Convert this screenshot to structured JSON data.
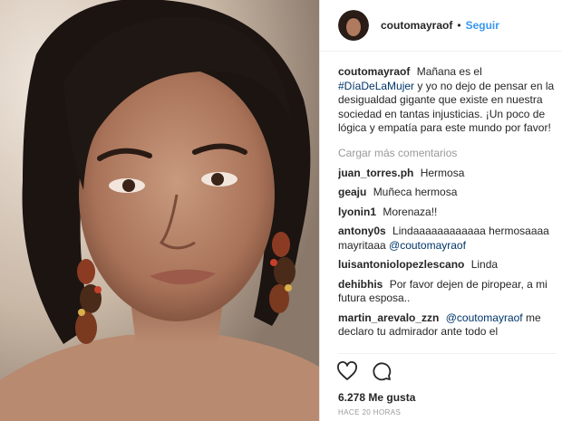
{
  "header": {
    "username": "coutomayraof",
    "separator": "•",
    "follow_label": "Seguir"
  },
  "caption": {
    "username": "coutomayraof",
    "text_before": "Mañana es el",
    "hashtag": "#DíaDeLaMujer",
    "text_after": "y yo no dejo de pensar en la desigualdad gigante que existe en nuestra sociedad en tantas injusticias. ¡Un poco de lógica y empatía para este mundo por favor!"
  },
  "load_more_label": "Cargar más comentarios",
  "comments": [
    {
      "username": "juan_torres.ph",
      "text": "Hermosa"
    },
    {
      "username": "geaju",
      "text": "Muñeca hermosa"
    },
    {
      "username": "lyonin1",
      "text": "Morenaza!!"
    },
    {
      "username": "antony0s",
      "text": "Lindaaaaaaaaaaaa hermosaaaa mayritaaa",
      "mention": "@coutomayraof"
    },
    {
      "username": "luisantoniolopezlescano",
      "text": "Linda"
    },
    {
      "username": "dehibhis",
      "text": "Por favor dejen de piropear, a mi futura esposa.."
    },
    {
      "username": "martin_arevalo_zzn",
      "mention": "@coutomayraof",
      "text": "me declaro tu admirador ante todo el"
    }
  ],
  "icons": {
    "like": "heart-icon",
    "comment": "comment-bubble-icon"
  },
  "likes_label": "6.278 Me gusta",
  "timestamp": "HACE 20 HORAS",
  "colors": {
    "link": "#3897f0",
    "hashtag": "#003569",
    "muted": "#999999"
  }
}
